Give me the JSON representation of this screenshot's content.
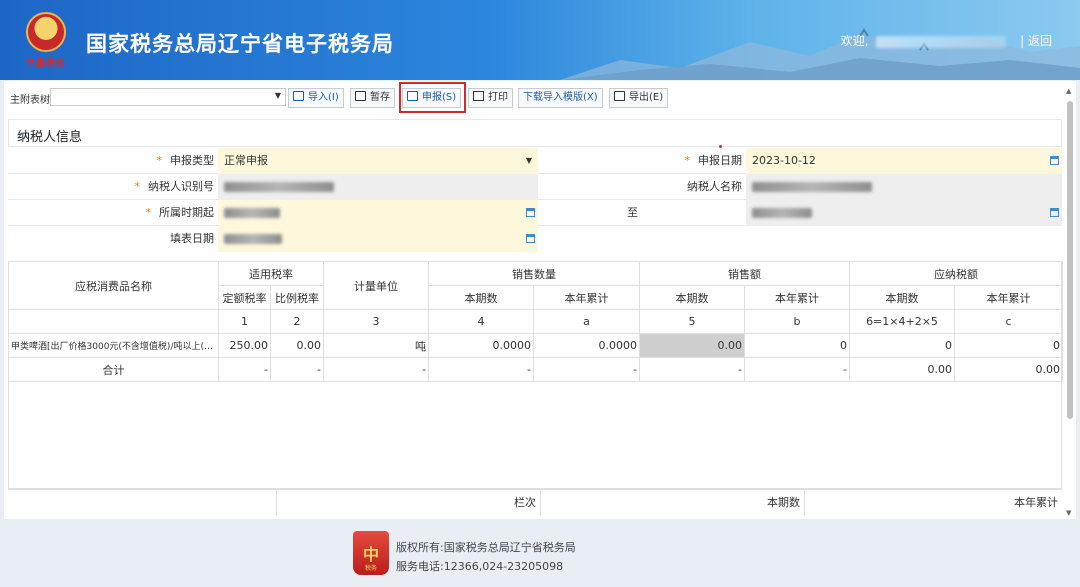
{
  "header": {
    "site_title": "国家税务总局辽宁省电子税务局",
    "emblem_text": "中国税务",
    "welcome_prefix": "欢迎,",
    "return_label": "| 返回"
  },
  "toolbar": {
    "tree_label": "主附表树:",
    "tree_value": "",
    "import_label": "导入(I)",
    "save_label": "暂存",
    "declare_label": "申报(S)",
    "print_label": "打印",
    "download_template_label": "下载导入模版(X)",
    "export_label": "导出(E)"
  },
  "section": {
    "title": "纳税人信息"
  },
  "taxpayer": {
    "declare_type_label": "申报类型",
    "declare_type_value": "正常申报",
    "declare_date_label": "申报日期",
    "declare_date_value": "2023-10-12",
    "taxpayer_id_label": "纳税人识别号",
    "taxpayer_name_label": "纳税人名称",
    "period_start_label": "所属时期起",
    "period_to_label": "至",
    "fill_date_label": "填表日期"
  },
  "table": {
    "col_name": "应税消费品名称",
    "col_rate": "适用税率",
    "col_unit": "计量单位",
    "col_sales_qty": "销售数量",
    "col_sales_amt": "销售额",
    "col_tax": "应纳税额",
    "sub_fixed": "定额税率",
    "sub_ratio": "比例税率",
    "sub_current": "本期数",
    "sub_ytd": "本年累计",
    "idx": [
      "1",
      "2",
      "3",
      "4",
      "a",
      "5",
      "b",
      "6=1×4+2×5",
      "c"
    ],
    "row1": {
      "name": "甲类啤酒[出厂价格3000元(不含增值税)/吨以上(含...",
      "fixed": "250.00",
      "ratio": "0.00",
      "unit": "吨",
      "qty_cur": "0.0000",
      "qty_ytd": "0.0000",
      "amt_cur": "0.00",
      "amt_ytd": "0",
      "tax_cur": "0",
      "tax_ytd": "0"
    },
    "total": {
      "name": "合计",
      "dash": "-",
      "tax_cur": "0.00",
      "tax_ytd": "0.00"
    }
  },
  "subtable": {
    "col_row": "栏次",
    "col_current": "本期数",
    "col_ytd": "本年累计"
  },
  "footer": {
    "logo_char": "中",
    "logo_sub": "税务",
    "copyright": "版权所有:国家税务总局辽宁省税务局",
    "service": "服务电话:12366,024-23205098"
  }
}
